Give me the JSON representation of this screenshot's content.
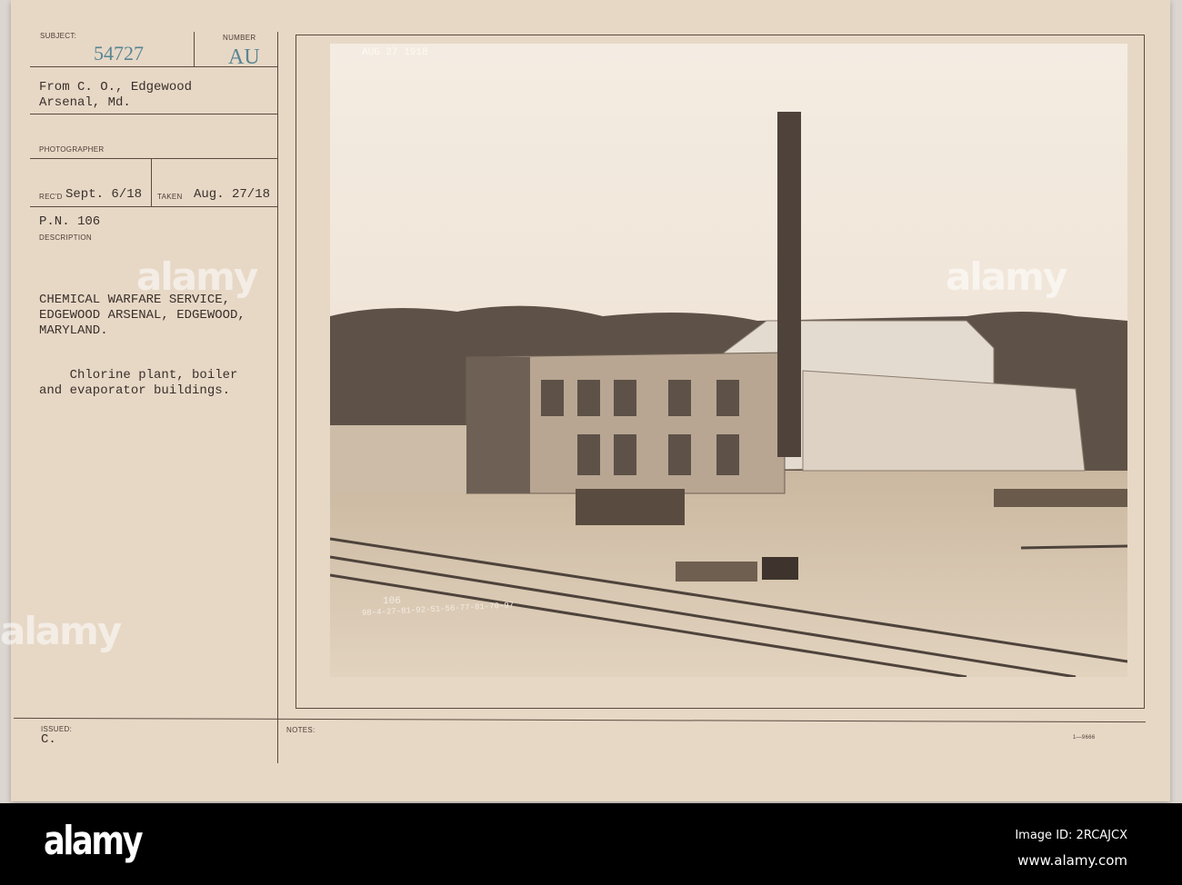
{
  "card": {
    "subject_label": "SUBJECT:",
    "subject_number": "54727",
    "number_label": "NUMBER",
    "number_value": "AU",
    "from": "From C. O., Edgewood\nArsenal, Md.",
    "photographer_label": "PHOTOGRAPHER",
    "recd_label": "REC'D",
    "recd_value": "Sept. 6/18",
    "taken_label": "TAKEN",
    "taken_value": "Aug. 27/18",
    "pn": "P.N. 106",
    "description_label": "DESCRIPTION",
    "description_heading": "CHEMICAL WARFARE SERVICE,\nEDGEWOOD ARSENAL, EDGEWOOD,\nMARYLAND.",
    "description_body": "    Chlorine plant, boiler\nand evaporator buildings.",
    "issued_label": "ISSUED:",
    "issued_value": "C.",
    "notes_label": "NOTES:",
    "form_number": "1—9666"
  },
  "photo": {
    "date_stamp": "AUG 27 1918",
    "negative_number": "106",
    "negative_series": "98-4-27-81-92-51-56-77-81-70-97"
  },
  "footer": {
    "logo": "alamy",
    "watermark": "alamy",
    "image_id": "Image ID: 2RCAJCX",
    "url": "www.alamy.com"
  }
}
